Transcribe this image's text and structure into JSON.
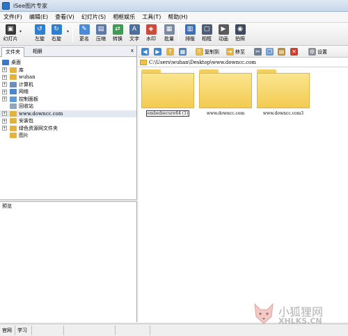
{
  "window": {
    "title": "iSee图片专家"
  },
  "menu": [
    "文件(F)",
    "编辑(E)",
    "查看(V)",
    "幻灯片(S)",
    "相框娱乐",
    "工具(T)",
    "帮助(H)"
  ],
  "toolbar": {
    "buttons": [
      {
        "label": "幻灯片",
        "icon": "slideshow-icon",
        "color": "#3a3a3a"
      },
      {
        "label": "左旋",
        "icon": "rotate-left-icon",
        "color": "#2f7fd0"
      },
      {
        "label": "右旋",
        "icon": "rotate-right-icon",
        "color": "#2f7fd0"
      },
      {
        "label": "更名",
        "icon": "rename-icon",
        "color": "#4b8ad6"
      },
      {
        "label": "压缩",
        "icon": "compress-icon",
        "color": "#5c7aa8"
      },
      {
        "label": "转换",
        "icon": "convert-icon",
        "color": "#3f9a55"
      },
      {
        "label": "文字",
        "icon": "text-icon",
        "color": "#4e6f9c"
      },
      {
        "label": "水印",
        "icon": "watermark-icon",
        "color": "#cc4a3a"
      },
      {
        "label": "批量",
        "icon": "batch-icon",
        "color": "#7a8aa0"
      },
      {
        "label": "排版",
        "icon": "layout-icon",
        "color": "#3b6fb6"
      },
      {
        "label": "相框",
        "icon": "frame-icon",
        "color": "#4d5d74"
      },
      {
        "label": "动画",
        "icon": "animation-icon",
        "color": "#5a5a5a"
      },
      {
        "label": "拍照",
        "icon": "camera-icon",
        "color": "#3e4a5e"
      }
    ]
  },
  "left_tabs": {
    "folders": "文件夹",
    "album": "相册",
    "close": "x"
  },
  "tree": [
    {
      "label": "桌面",
      "level": 0,
      "expander": "",
      "icon": "desktop-icon",
      "color": "#3c78c8"
    },
    {
      "label": "库",
      "level": 1,
      "expander": "+",
      "icon": "library-icon",
      "color": "#e2b43e"
    },
    {
      "label": "wuhan",
      "level": 1,
      "expander": "+",
      "icon": "user-folder-icon",
      "color": "#e2b43e"
    },
    {
      "label": "计算机",
      "level": 1,
      "expander": "+",
      "icon": "computer-icon",
      "color": "#6c8fb8"
    },
    {
      "label": "网络",
      "level": 1,
      "expander": "+",
      "icon": "network-icon",
      "color": "#4a86c9"
    },
    {
      "label": "控制面板",
      "level": 1,
      "expander": "+",
      "icon": "control-panel-icon",
      "color": "#5a9ad6"
    },
    {
      "label": "回收站",
      "level": 1,
      "expander": "",
      "icon": "recycle-bin-icon",
      "color": "#8fa6bf"
    },
    {
      "label": "www.downcc.com",
      "level": 1,
      "expander": "+",
      "icon": "folder-icon",
      "color": "#e2b43e",
      "selected": true
    },
    {
      "label": "安装包",
      "level": 1,
      "expander": "+",
      "icon": "folder-icon",
      "color": "#e2b43e"
    },
    {
      "label": "绿色资源网文件夹",
      "level": 1,
      "expander": "+",
      "icon": "folder-icon",
      "color": "#e2b43e"
    },
    {
      "label": "图片",
      "level": 1,
      "expander": "",
      "icon": "folder-icon",
      "color": "#e2b43e"
    }
  ],
  "preview": {
    "label": "预览"
  },
  "right_toolbar": {
    "copy_to": "复制到",
    "move_to": "移至",
    "settings": "设置"
  },
  "path": "C:\\Users\\wuhan\\Desktop\\www.downcc.com",
  "thumbnails": [
    {
      "name": "embedsecure64 (1)",
      "selected": true
    },
    {
      "name": "www.downcc.com",
      "selected": false
    },
    {
      "name": "www.downcc.com3",
      "selected": false
    }
  ],
  "status": [
    "官网",
    "学习"
  ],
  "watermark": {
    "line1": "小狐狸网",
    "line2": "XHLKS.CN"
  }
}
